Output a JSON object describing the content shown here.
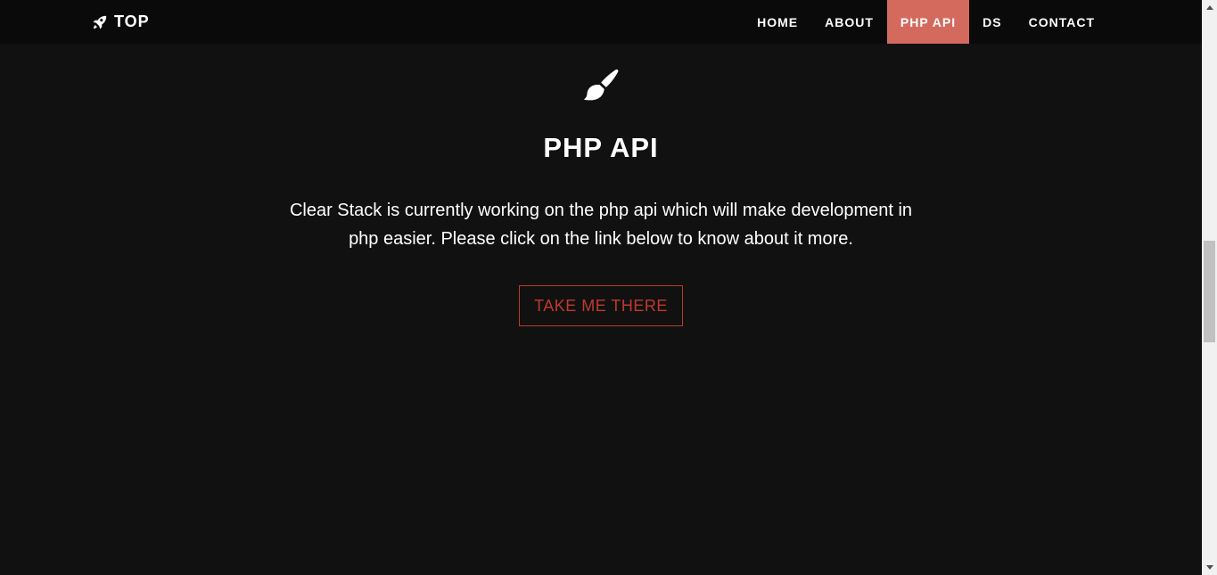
{
  "navbar": {
    "brand_label": "TOP",
    "brand_icon": "rocket-icon",
    "items": [
      {
        "label": "HOME"
      },
      {
        "label": "ABOUT"
      },
      {
        "label": "PHP API"
      },
      {
        "label": "DS"
      },
      {
        "label": "CONTACT"
      }
    ],
    "active_index": 2,
    "active_color": "#d46a5e"
  },
  "section": {
    "icon": "paint-brush-icon",
    "title": "PHP API",
    "description": "Clear Stack is currently working on the php api which will make development in php easier. Please click on the link below to know about it more.",
    "button_label": "TAKE ME THERE",
    "button_color": "#c0392b"
  },
  "colors": {
    "background": "#111111",
    "navbar_background": "#0a0a0a",
    "text": "#ffffff"
  }
}
